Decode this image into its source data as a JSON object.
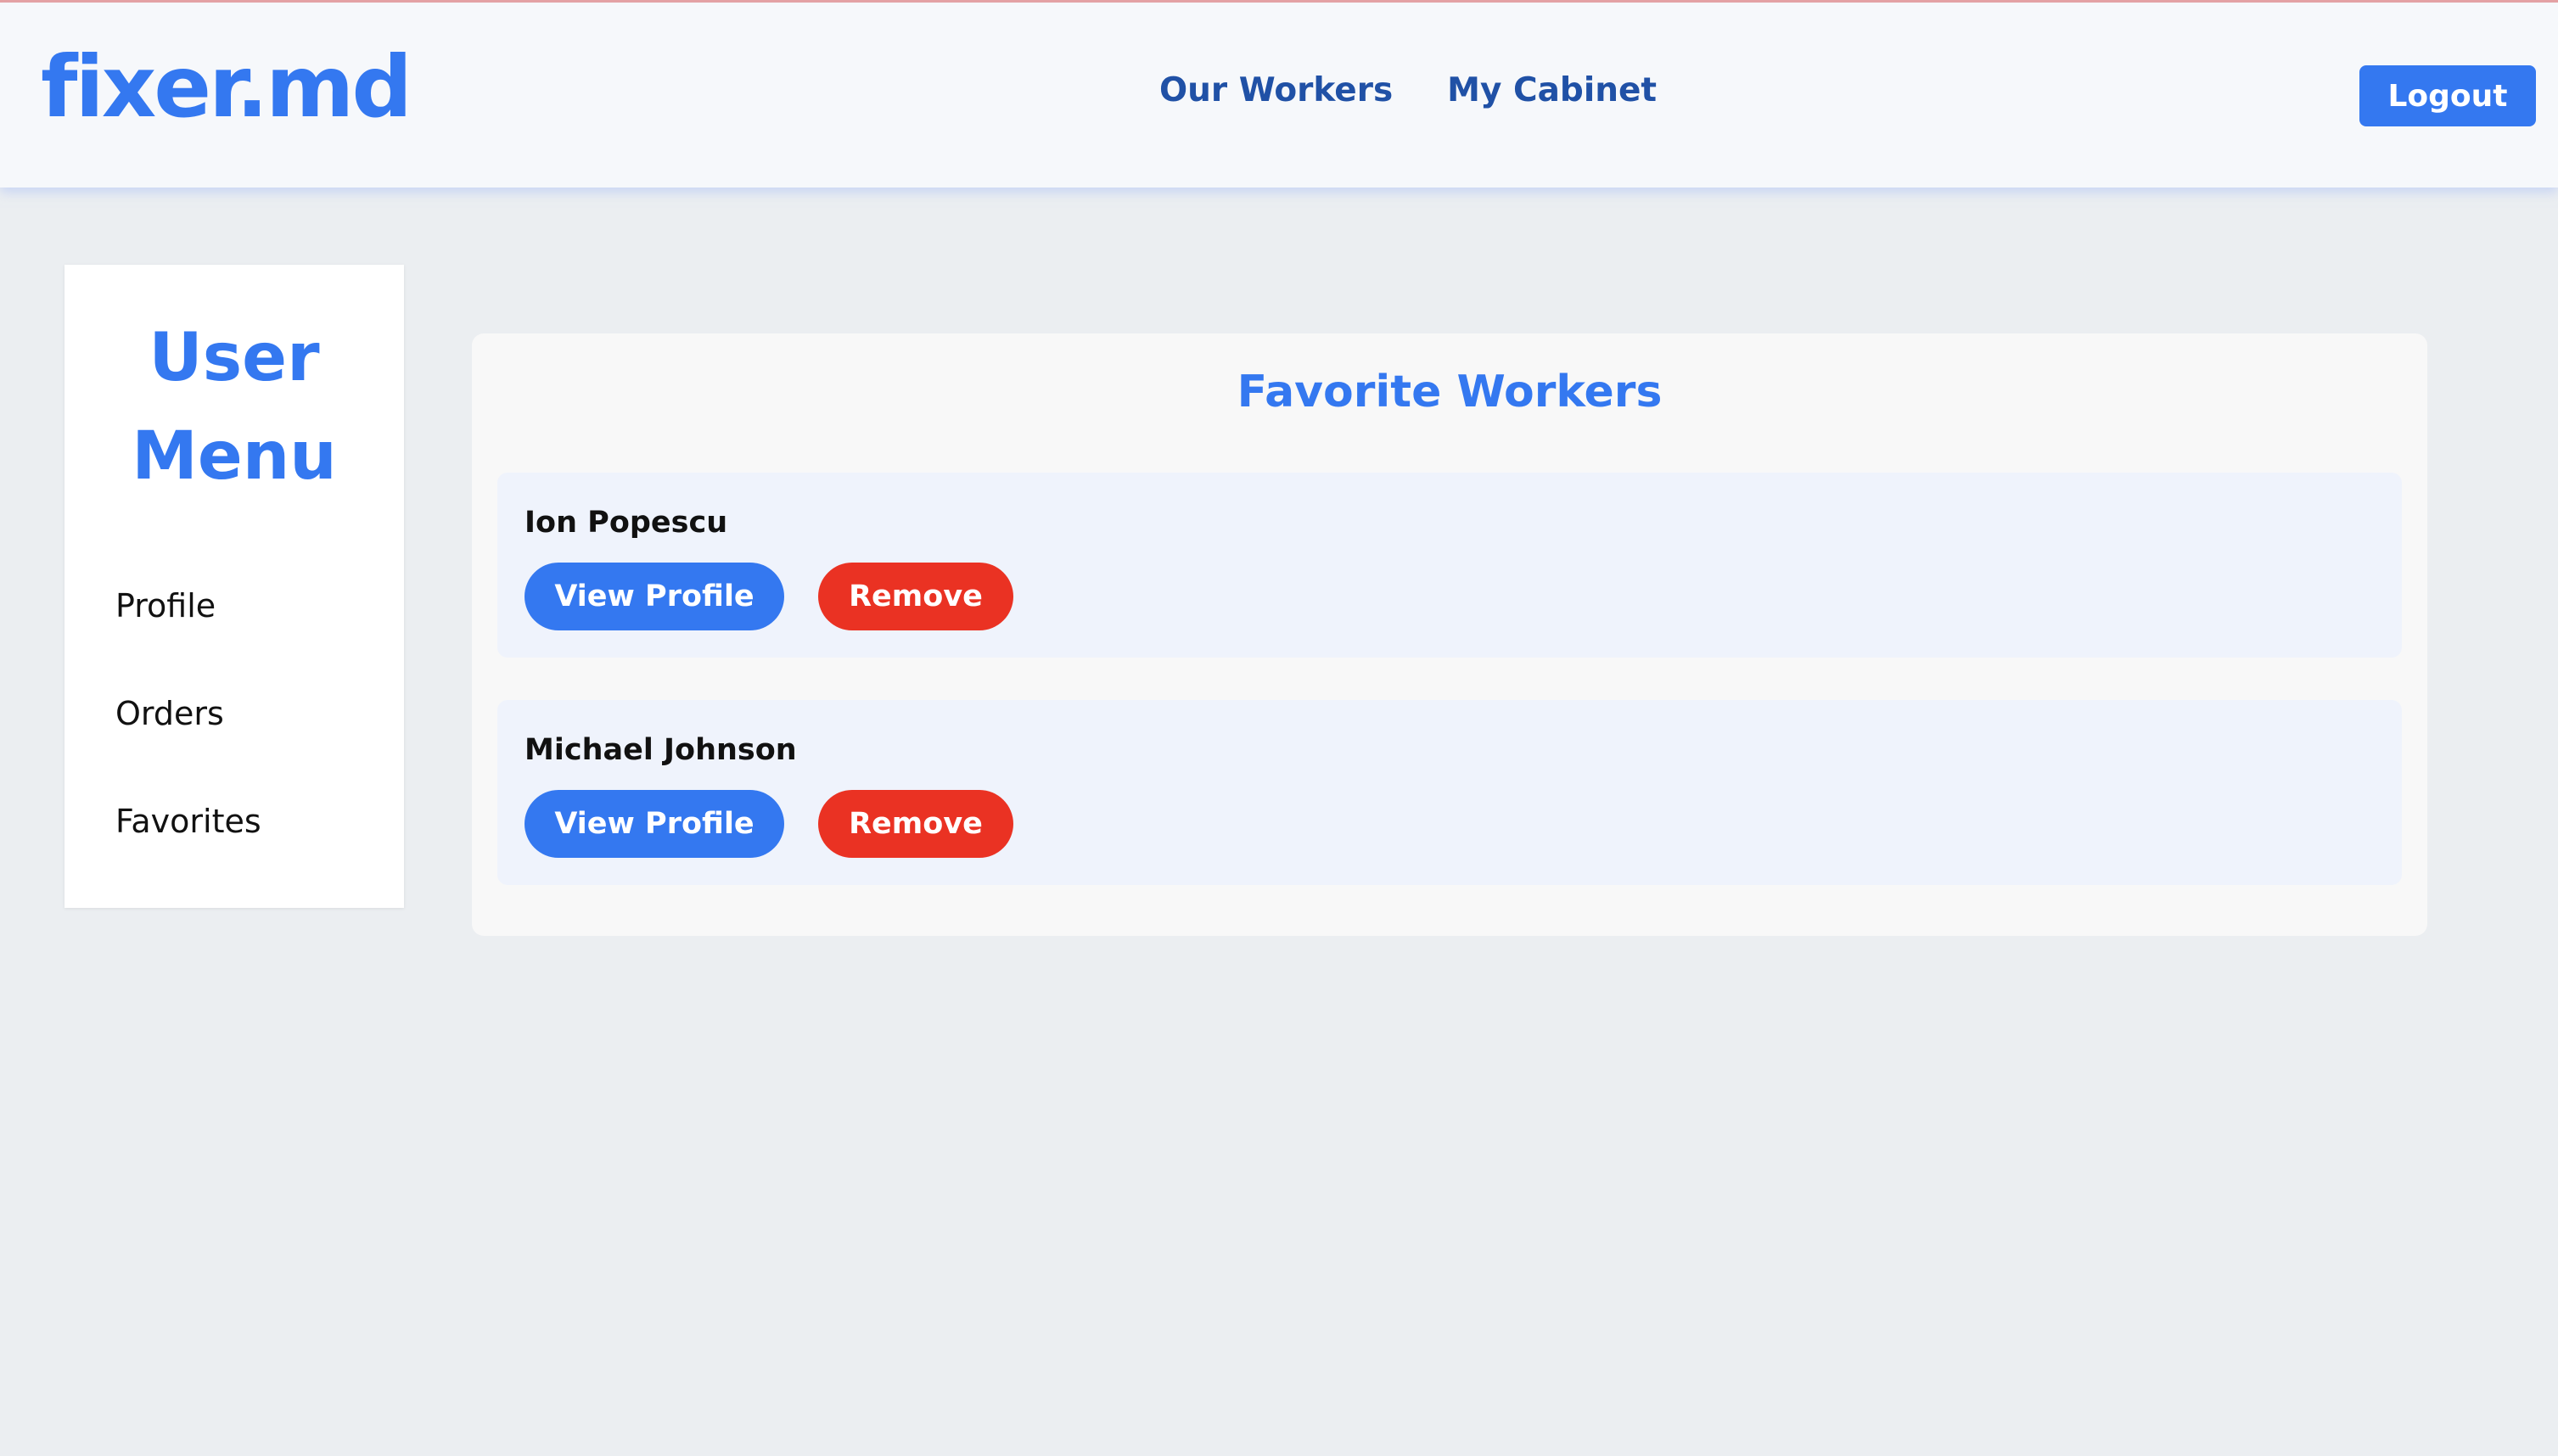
{
  "header": {
    "logo": "fixer.md",
    "nav": [
      "Our Workers",
      "My Cabinet"
    ],
    "logout_label": "Logout"
  },
  "sidebar": {
    "title": "User Menu",
    "items": [
      "Profile",
      "Orders",
      "Favorites"
    ]
  },
  "main": {
    "title": "Favorite Workers",
    "workers": [
      {
        "name": "Ion Popescu",
        "view_label": "View Profile",
        "remove_label": "Remove"
      },
      {
        "name": "Michael Johnson",
        "view_label": "View Profile",
        "remove_label": "Remove"
      }
    ]
  },
  "colors": {
    "accent": "#3478f0",
    "nav_text": "#2051a6",
    "danger": "#ea3223",
    "page_bg": "#ebeef1",
    "card_bg": "#eff3fc"
  }
}
